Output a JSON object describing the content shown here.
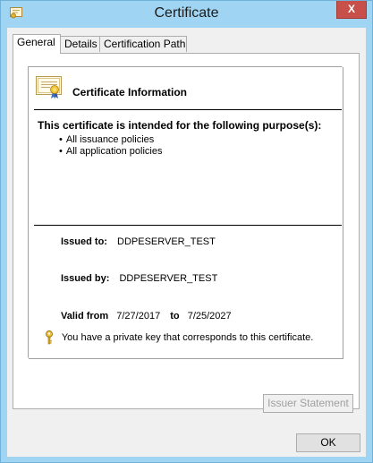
{
  "window": {
    "title": "Certificate",
    "close_label": "X"
  },
  "tabs": [
    {
      "label": "General"
    },
    {
      "label": "Details"
    },
    {
      "label": "Certification Path"
    }
  ],
  "certificate": {
    "info_title": "Certificate Information",
    "purpose_heading": "This certificate is intended for the following purpose(s):",
    "purposes": [
      "All issuance policies",
      "All application policies"
    ],
    "issued_to_label": "Issued to:",
    "issued_to_value": "DDPESERVER_TEST",
    "issued_by_label": "Issued by:",
    "issued_by_value": "DDPESERVER_TEST",
    "valid_from_label": "Valid from",
    "valid_from_value": "7/27/2017",
    "valid_to_label": "to",
    "valid_to_value": "7/25/2027",
    "private_key_note": "You have a private key that corresponds to this certificate."
  },
  "buttons": {
    "issuer_statement": "Issuer Statement",
    "ok": "OK"
  },
  "icons": {
    "app": "certificate-app-icon",
    "certificate": "certificate-icon",
    "key": "key-icon"
  },
  "colors": {
    "titlebar": "#9fd4f3",
    "close_button": "#c7504a",
    "dialog_face": "#f0f0f0"
  }
}
